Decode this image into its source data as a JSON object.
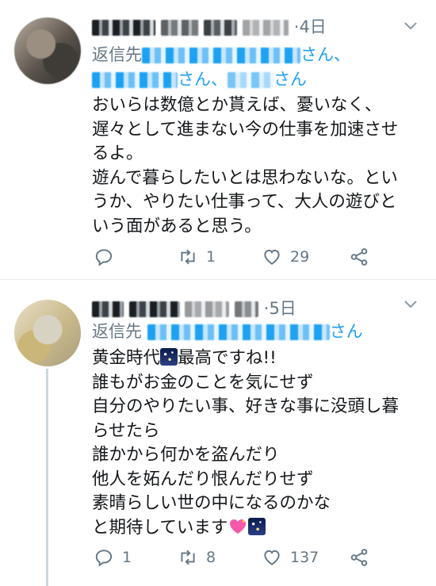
{
  "tweets": [
    {
      "time": "4日",
      "replying_prefix": "返信先",
      "mention_suffix_1": "さん、",
      "mention_suffix_2": "さん、",
      "mention_suffix_3": "さん",
      "body": [
        "おいらは数億とか貰えば、憂いなく、",
        "遅々として進まない今の仕事を加速させ",
        "るよ。",
        "遊んで暮らしたいとは思わないな。とい",
        "うか、やりたい仕事って、大人の遊びと",
        "いう面があると思う。"
      ],
      "reply_count": "",
      "retweet_count": "1",
      "like_count": "29"
    },
    {
      "time": "5日",
      "replying_prefix": "返信先",
      "mention_suffix_1": "さん",
      "body_line1_a": "黄金時代",
      "body_line1_b": "最高ですね!!",
      "body": [
        "誰もがお金のことを気にせず",
        "自分のやりたい事、好きな事に没頭し暮",
        "らせたら",
        "誰かから何かを盗んだり",
        "他人を妬んだり恨んだりせず",
        "素晴らしい世の中になるのかな"
      ],
      "body_last": "と期待しています",
      "reply_count": "1",
      "retweet_count": "8",
      "like_count": "137"
    }
  ],
  "icons": {
    "reply": "reply-icon",
    "retweet": "retweet-icon",
    "like": "heart-icon",
    "share": "share-icon",
    "menu": "chevron-down-icon"
  },
  "colors": {
    "text": "#14171a",
    "muted": "#657786",
    "link": "#1da1f2",
    "divider": "#e6ecf0"
  }
}
